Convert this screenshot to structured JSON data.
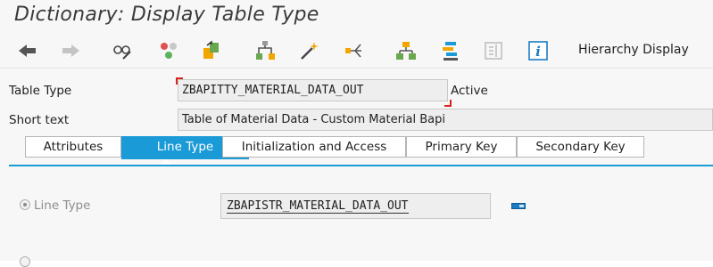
{
  "window": {
    "title": "Dictionary: Display Table Type"
  },
  "toolbar": {
    "icons": [
      "back-arrow-icon",
      "forward-arrow-icon",
      "display-change-icon",
      "other-object-icon",
      "check-icon",
      "activate-icon",
      "where-used-icon",
      "object-list-icon",
      "navigation-window-icon",
      "technical-settings-icon",
      "documentation-icon",
      "info-icon"
    ],
    "hierarchy_label": "Hierarchy Display"
  },
  "header": {
    "table_type_label": "Table Type",
    "table_type_value": "ZBAPITTY_MATERIAL_DATA_OUT",
    "status": "Active",
    "short_text_label": "Short text",
    "short_text_value": "Table of Material Data - Custom Material Bapi"
  },
  "tabs": [
    {
      "label": "Attributes",
      "active": false
    },
    {
      "label": "Line Type",
      "active": true
    },
    {
      "label": "Initialization and Access",
      "active": false
    },
    {
      "label": "Primary Key",
      "active": false
    },
    {
      "label": "Secondary Key",
      "active": false
    }
  ],
  "line_type": {
    "option_label": "Line Type",
    "value": "ZBAPISTR_MATERIAL_DATA_OUT"
  },
  "colors": {
    "accent": "#1a9ad6",
    "required": "#d9241c"
  }
}
